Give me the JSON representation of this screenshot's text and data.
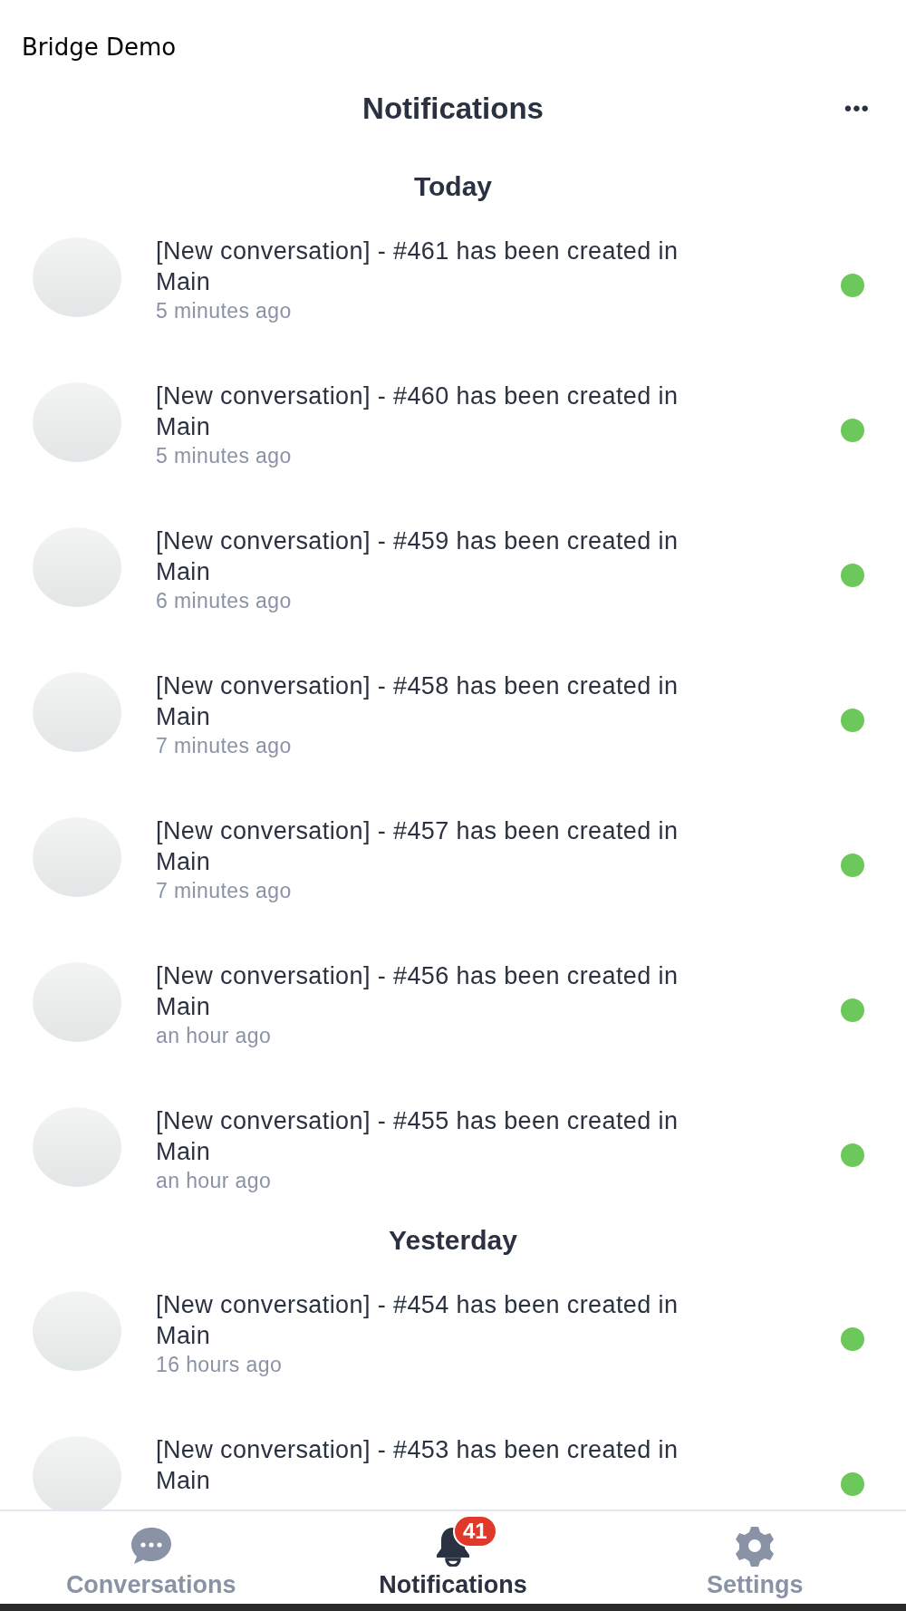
{
  "app_title": "Bridge Demo",
  "header": {
    "title": "Notifications",
    "menu": "•••"
  },
  "sections": [
    {
      "heading": "Today",
      "items": [
        {
          "text": "[New conversation] - #461 has been created in Main",
          "time": "5 minutes ago",
          "unread": true
        },
        {
          "text": "[New conversation] - #460 has been created in Main",
          "time": "5 minutes ago",
          "unread": true
        },
        {
          "text": "[New conversation] - #459 has been created in Main",
          "time": "6 minutes ago",
          "unread": true
        },
        {
          "text": "[New conversation] - #458 has been created in Main",
          "time": "7 minutes ago",
          "unread": true
        },
        {
          "text": "[New conversation] - #457 has been created in Main",
          "time": "7 minutes ago",
          "unread": true
        },
        {
          "text": "[New conversation] - #456 has been created in Main",
          "time": "an hour ago",
          "unread": true
        },
        {
          "text": "[New conversation] - #455 has been created in Main",
          "time": "an hour ago",
          "unread": true
        }
      ]
    },
    {
      "heading": "Yesterday",
      "items": [
        {
          "text": "[New conversation] - #454 has been created in Main",
          "time": "16 hours ago",
          "unread": true
        },
        {
          "text": "[New conversation] - #453 has been created in Main",
          "unread": true
        }
      ]
    }
  ],
  "tabs": [
    {
      "kind": "chat",
      "label": "Conversations",
      "selected": false
    },
    {
      "kind": "bell",
      "label": "Notifications",
      "selected": true,
      "badge": "41"
    },
    {
      "kind": "gear",
      "label": "Settings",
      "selected": false
    }
  ]
}
